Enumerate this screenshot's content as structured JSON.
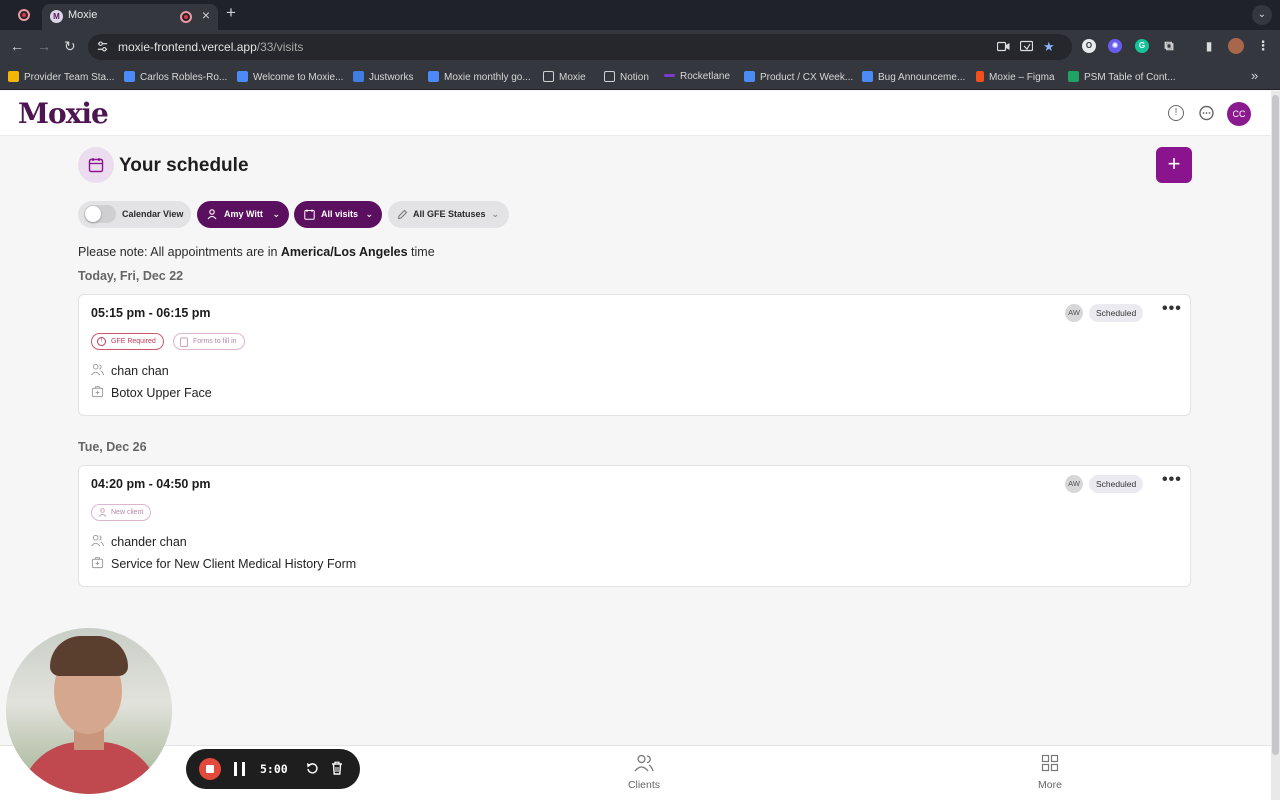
{
  "browser": {
    "tab_title": "Moxie",
    "tab_close": "×",
    "new_tab": "+",
    "tab_menu": "⌄",
    "url_host": "moxie-frontend.vercel.app",
    "url_path": "/33/visits",
    "bookmarks": [
      {
        "label": "Provider Team Sta...",
        "color": "#f2b705"
      },
      {
        "label": "Carlos Robles-Ro...",
        "color": "#4c8bf5"
      },
      {
        "label": "Welcome to Moxie...",
        "color": "#4c8bf5"
      },
      {
        "label": "Justworks",
        "color": "#3f7de0"
      },
      {
        "label": "Moxie monthly go...",
        "color": "#4c8bf5"
      },
      {
        "label": "Moxie",
        "color": "folder"
      },
      {
        "label": "Notion",
        "color": "folder"
      },
      {
        "label": "Rocketlane",
        "color": "#7a3bd1"
      },
      {
        "label": "Product / CX Week...",
        "color": "#4c8bf5"
      },
      {
        "label": "Bug Announceme...",
        "color": "#4c8bf5"
      },
      {
        "label": "Moxie – Figma",
        "color": "#f24e1e"
      },
      {
        "label": "PSM Table of Cont...",
        "color": "#1fa463"
      }
    ],
    "bookmarks_overflow": "»"
  },
  "app": {
    "logo": "Moxie",
    "user_initials": "CC",
    "page_title": "Your schedule",
    "add_button": "+",
    "filters": {
      "calendar_view": "Calendar View",
      "provider": "Amy Witt",
      "visits": "All visits",
      "gfe_status": "All GFE Statuses"
    },
    "note_prefix": "Please note: All appointments are in ",
    "note_timezone": "America/Los Angeles",
    "note_suffix": " time",
    "days": [
      {
        "label": "Today, Fri, Dec 22",
        "appointment": {
          "time": "05:15 pm - 06:15 pm",
          "provider_initials": "AW",
          "status": "Scheduled",
          "tags": [
            "GFE Required",
            "Forms to fill in"
          ],
          "client": "chan chan",
          "service": "Botox Upper Face"
        }
      },
      {
        "label": "Tue, Dec 26",
        "appointment": {
          "time": "04:20 pm - 04:50 pm",
          "provider_initials": "AW",
          "status": "Scheduled",
          "tags": [
            "New client"
          ],
          "client": "chander chan",
          "service": "Service for New Client Medical History Form"
        }
      }
    ],
    "more_menu": "•••",
    "bottom_nav": {
      "clients": "Clients",
      "more": "More"
    }
  },
  "recorder": {
    "time": "5:00"
  }
}
